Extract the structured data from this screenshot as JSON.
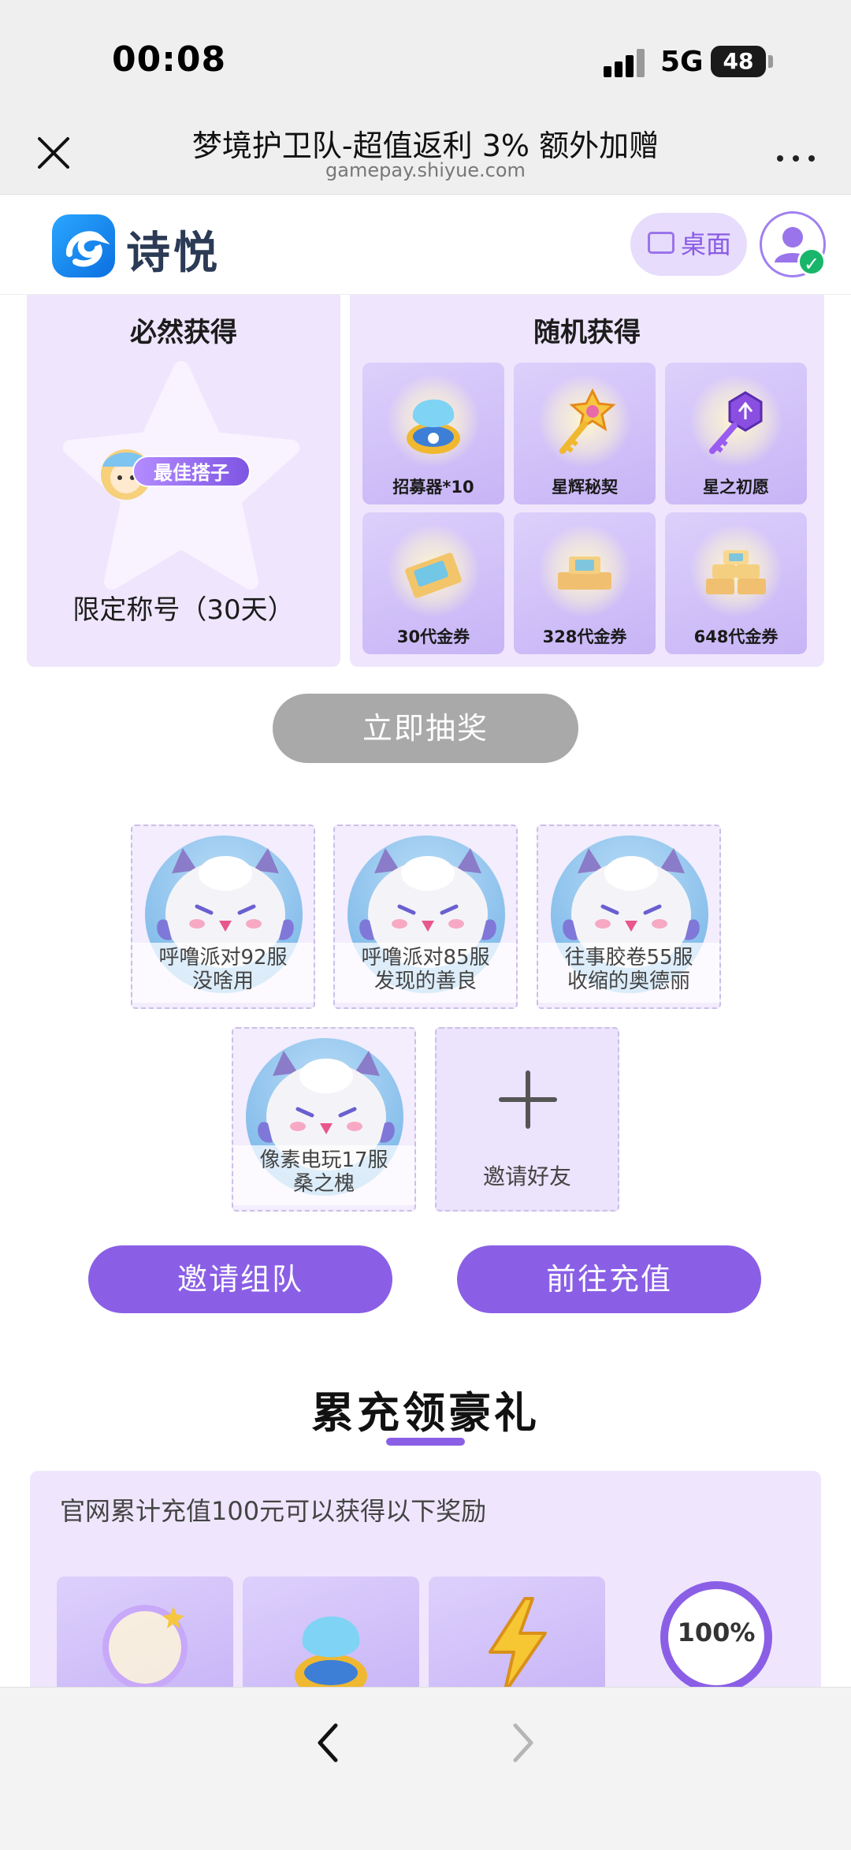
{
  "status_bar": {
    "time": "00:08",
    "network": "5G",
    "battery": "48"
  },
  "browser": {
    "title": "梦境护卫队-超值返利 3% 额外加赠",
    "url": "gamepay.shiyue.com",
    "more": "..."
  },
  "site": {
    "logo_text": "诗悦",
    "desktop_label": "桌面"
  },
  "guaranteed": {
    "heading": "必然获得",
    "badge_text": "最佳搭子",
    "title_caption": "限定称号（30天）"
  },
  "random": {
    "heading": "随机获得",
    "items": [
      {
        "label": "招募器*10",
        "icon": "recruiter-icon"
      },
      {
        "label": "星辉秘契",
        "icon": "star-key-icon"
      },
      {
        "label": "星之初愿",
        "icon": "purple-key-icon"
      },
      {
        "label": "30代金券",
        "icon": "voucher-icon"
      },
      {
        "label": "328代金券",
        "icon": "voucher-stack-icon"
      },
      {
        "label": "648代金券",
        "icon": "voucher-pile-icon"
      }
    ]
  },
  "draw_button": "立即抽奖",
  "team": {
    "members": [
      {
        "line1": "呼噜派对92服",
        "line2": "没啥用"
      },
      {
        "line1": "呼噜派对85服",
        "line2": "发现的善良"
      },
      {
        "line1": "往事胶卷55服",
        "line2": "收缩的奥德丽"
      },
      {
        "line1": "像素电玩17服",
        "line2": "桑之槐"
      }
    ],
    "invite_label": "邀请好友"
  },
  "buttons": {
    "invite_team": "邀请组队",
    "go_recharge": "前往充值"
  },
  "accumulate": {
    "title": "累充领豪礼",
    "description": "官网累计充值100元可以获得以下奖励",
    "progress_text": "100%",
    "progress": 1.0,
    "items": [
      {
        "icon": "halo-frame-icon"
      },
      {
        "icon": "recruiter-icon"
      },
      {
        "icon": "lightning-icon"
      }
    ]
  },
  "colors": {
    "accent": "#8a5fe6",
    "panel": "#efe6fd",
    "disabled": "#a9a9a9"
  }
}
